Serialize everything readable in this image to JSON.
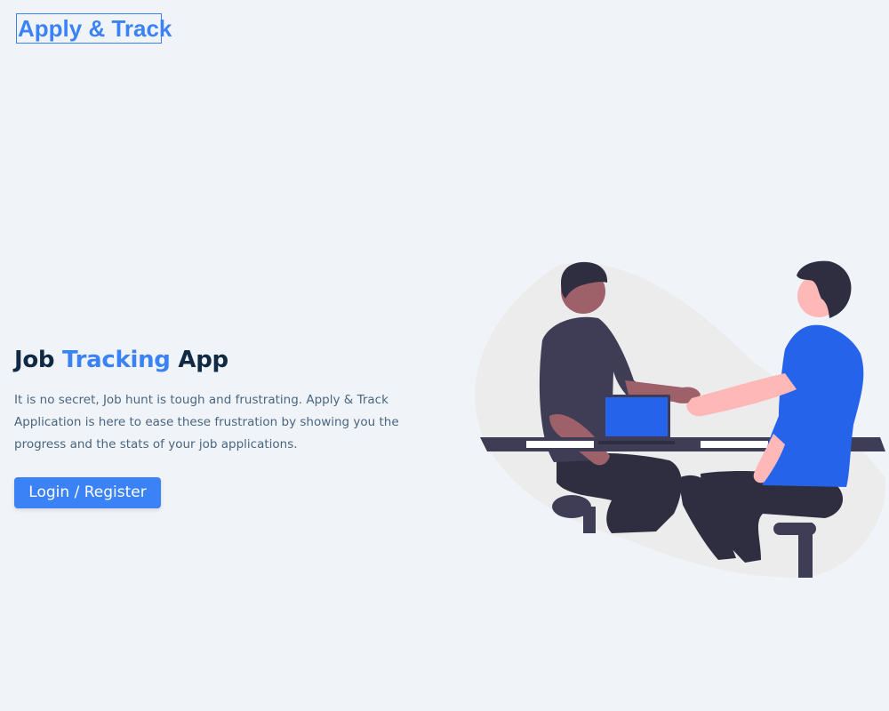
{
  "header": {
    "logo_text": "Apply & Track"
  },
  "hero": {
    "title_part1": "Job",
    "title_accent": "Tracking",
    "title_part2": "App",
    "description": "It is no secret, Job hunt is tough and frustrating. Apply & Track Application is here to ease these frustration by showing you the progress and the stats of your job applications.",
    "cta_label": "Login / Register"
  },
  "colors": {
    "background": "#f0f4f8",
    "primary": "#3b82f6",
    "heading": "#102a43",
    "text": "#486581",
    "illustration_blue": "#2563eb",
    "illustration_dark": "#3f3d56",
    "illustration_skin_dark": "#9e616a",
    "illustration_skin_light": "#ffb8b8"
  },
  "illustration": {
    "name": "handshake-illustration"
  }
}
